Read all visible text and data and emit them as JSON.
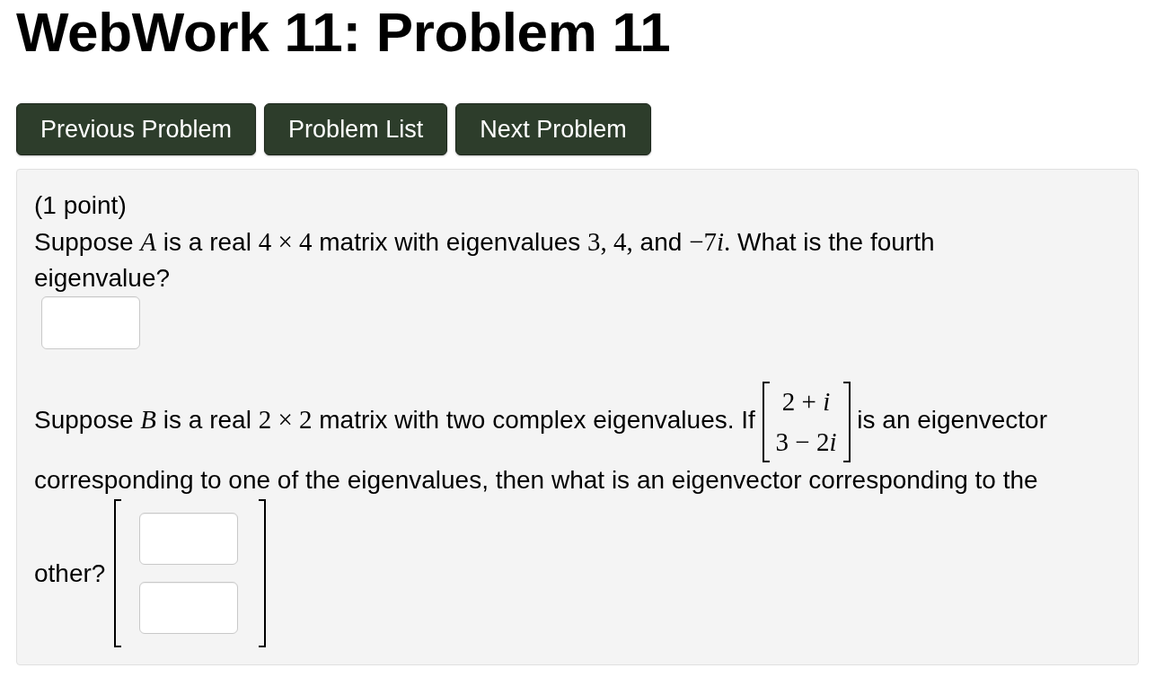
{
  "page_title": "WebWork 11: Problem 11",
  "nav_buttons": [
    {
      "label": "Previous Problem"
    },
    {
      "label": "Problem List"
    },
    {
      "label": "Next Problem"
    }
  ],
  "problem": {
    "points": "(1 point)",
    "part_1": {
      "question": [
        {
          "kind": "text",
          "text": "Suppose "
        },
        {
          "kind": "var",
          "text": "A"
        },
        {
          "kind": "text",
          "text": " is a real "
        },
        {
          "kind": "math",
          "text": "4 × 4"
        },
        {
          "kind": "text",
          "text": " matrix with eigenvalues "
        },
        {
          "kind": "math",
          "text": "3, 4,"
        },
        {
          "kind": "text",
          "text": " and "
        },
        {
          "kind": "math",
          "text": "−7"
        },
        {
          "kind": "var",
          "text": "i"
        },
        {
          "kind": "math",
          "text": "."
        },
        {
          "kind": "text",
          "text": " What is the fourth eigenvalue?"
        }
      ],
      "answer": {
        "kind": "blank"
      }
    },
    "part_2": {
      "question": [
        {
          "kind": "text",
          "text": "Suppose "
        },
        {
          "kind": "var",
          "text": "B"
        },
        {
          "kind": "text",
          "text": " is a real "
        },
        {
          "kind": "math",
          "text": "2 × 2"
        },
        {
          "kind": "text",
          "text": " matrix with two complex eigenvalues. If "
        },
        {
          "kind": "vector",
          "entries": [
            [
              {
                "kind": "math",
                "text": "2 + "
              },
              {
                "kind": "var",
                "text": "i"
              }
            ],
            [
              {
                "kind": "math",
                "text": "3 − 2"
              },
              {
                "kind": "var",
                "text": "i"
              }
            ]
          ]
        },
        {
          "kind": "text",
          "text": " is an eigenvector corresponding to one of the eigenvalues, then what is an eigenvector corresponding to the"
        }
      ],
      "question_end": "other?",
      "answer_vector": [
        {
          "kind": "blank"
        },
        {
          "kind": "blank"
        }
      ]
    }
  }
}
